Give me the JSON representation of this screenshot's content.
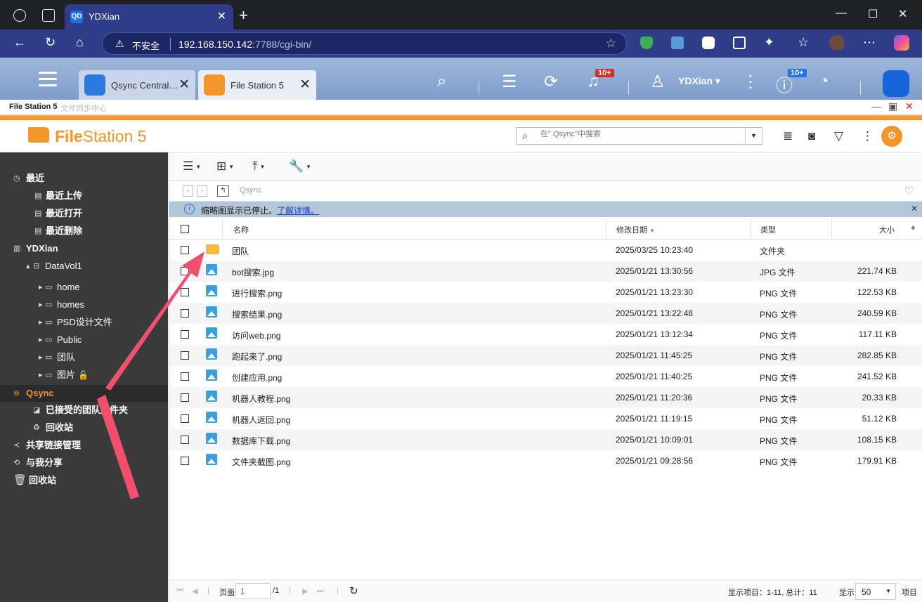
{
  "browser": {
    "tab_title": "YDXian",
    "tab_favicon": "QD",
    "security_label": "不安全",
    "url_host": "192.168.150.142",
    "url_rest": ":7788/cgi-bin/"
  },
  "qts": {
    "tabs": [
      {
        "label": "Qsync Central…"
      },
      {
        "label": "File Station 5"
      }
    ],
    "notif_badge": "10+",
    "user_name": "YDXian",
    "info_badge": "10+"
  },
  "window": {
    "title": "File Station 5",
    "subtitle": "文件同步中心"
  },
  "app": {
    "logo_bold": "File",
    "logo_rest": "Station 5",
    "search_placeholder": "在\".Qsync\"中搜索"
  },
  "sidebar": {
    "items": [
      {
        "label": "最近",
        "icon": "clock-icon"
      },
      {
        "label": "最近上传",
        "icon": "list-icon"
      },
      {
        "label": "最近打开",
        "icon": "list-icon"
      },
      {
        "label": "最近删除",
        "icon": "list-icon"
      },
      {
        "label": "YDXian",
        "icon": "nas-icon"
      },
      {
        "label": "DataVol1",
        "icon": "volume-icon"
      },
      {
        "label": "home",
        "icon": "folder-icon"
      },
      {
        "label": "homes",
        "icon": "folder-icon"
      },
      {
        "label": "PSD设计文件",
        "icon": "folder-icon"
      },
      {
        "label": "Public",
        "icon": "folder-icon"
      },
      {
        "label": "团队",
        "icon": "folder-icon"
      },
      {
        "label": "图片",
        "icon": "folder-icon"
      },
      {
        "label": "Qsync",
        "icon": "qsync-icon"
      },
      {
        "label": "已接受的团队文件夹",
        "icon": "team-folder-icon"
      },
      {
        "label": "回收站",
        "icon": "recycle-icon"
      },
      {
        "label": "共享链接管理",
        "icon": "share-icon"
      },
      {
        "label": "与我分享",
        "icon": "shared-with-me-icon"
      },
      {
        "label": "回收站",
        "icon": "trash-icon"
      }
    ]
  },
  "path": {
    "current": "Qsync"
  },
  "infobar": {
    "message": "缩略图显示已停止。",
    "link": "了解详情。"
  },
  "table": {
    "headers": {
      "name": "名称",
      "modified": "修改日期",
      "type": "类型",
      "size": "大小"
    },
    "rows": [
      {
        "name": "团队",
        "modified": "2025/03/25 10:23:40",
        "type": "文件夹",
        "size": "",
        "kind": "folder"
      },
      {
        "name": "bot搜索.jpg",
        "modified": "2025/01/21 13:30:56",
        "type": "JPG 文件",
        "size": "221.74 KB",
        "kind": "image"
      },
      {
        "name": "进行搜索.png",
        "modified": "2025/01/21 13:23:30",
        "type": "PNG 文件",
        "size": "122.53 KB",
        "kind": "image"
      },
      {
        "name": "搜索结果.png",
        "modified": "2025/01/21 13:22:48",
        "type": "PNG 文件",
        "size": "240.59 KB",
        "kind": "image"
      },
      {
        "name": "访问web.png",
        "modified": "2025/01/21 13:12:34",
        "type": "PNG 文件",
        "size": "117.11 KB",
        "kind": "image"
      },
      {
        "name": "跑起来了.png",
        "modified": "2025/01/21 11:45:25",
        "type": "PNG 文件",
        "size": "282.85 KB",
        "kind": "image"
      },
      {
        "name": "创建应用.png",
        "modified": "2025/01/21 11:40:25",
        "type": "PNG 文件",
        "size": "241.52 KB",
        "kind": "image"
      },
      {
        "name": "机器人教程.png",
        "modified": "2025/01/21 11:20:36",
        "type": "PNG 文件",
        "size": "20.33 KB",
        "kind": "image"
      },
      {
        "name": "机器人返回.png",
        "modified": "2025/01/21 11:19:15",
        "type": "PNG 文件",
        "size": "51.12 KB",
        "kind": "image"
      },
      {
        "name": "数据库下载.png",
        "modified": "2025/01/21 10:09:01",
        "type": "PNG 文件",
        "size": "108.15 KB",
        "kind": "image"
      },
      {
        "name": "文件夹截图.png",
        "modified": "2025/01/21 09:28:56",
        "type": "PNG 文件",
        "size": "179.91 KB",
        "kind": "image"
      }
    ]
  },
  "footer": {
    "page_label": "页面",
    "page_value": "1",
    "page_total": "/1",
    "items_info": "显示项目：1-11, 总计：11",
    "show_label": "显示",
    "per_page": "50",
    "items_label": "项目"
  },
  "colors": {
    "accent_orange": "#f2962a",
    "sidebar_bg": "#3a3a3a",
    "browser_blue": "#2f3c88",
    "annotation_arrow": "#f0506e"
  }
}
